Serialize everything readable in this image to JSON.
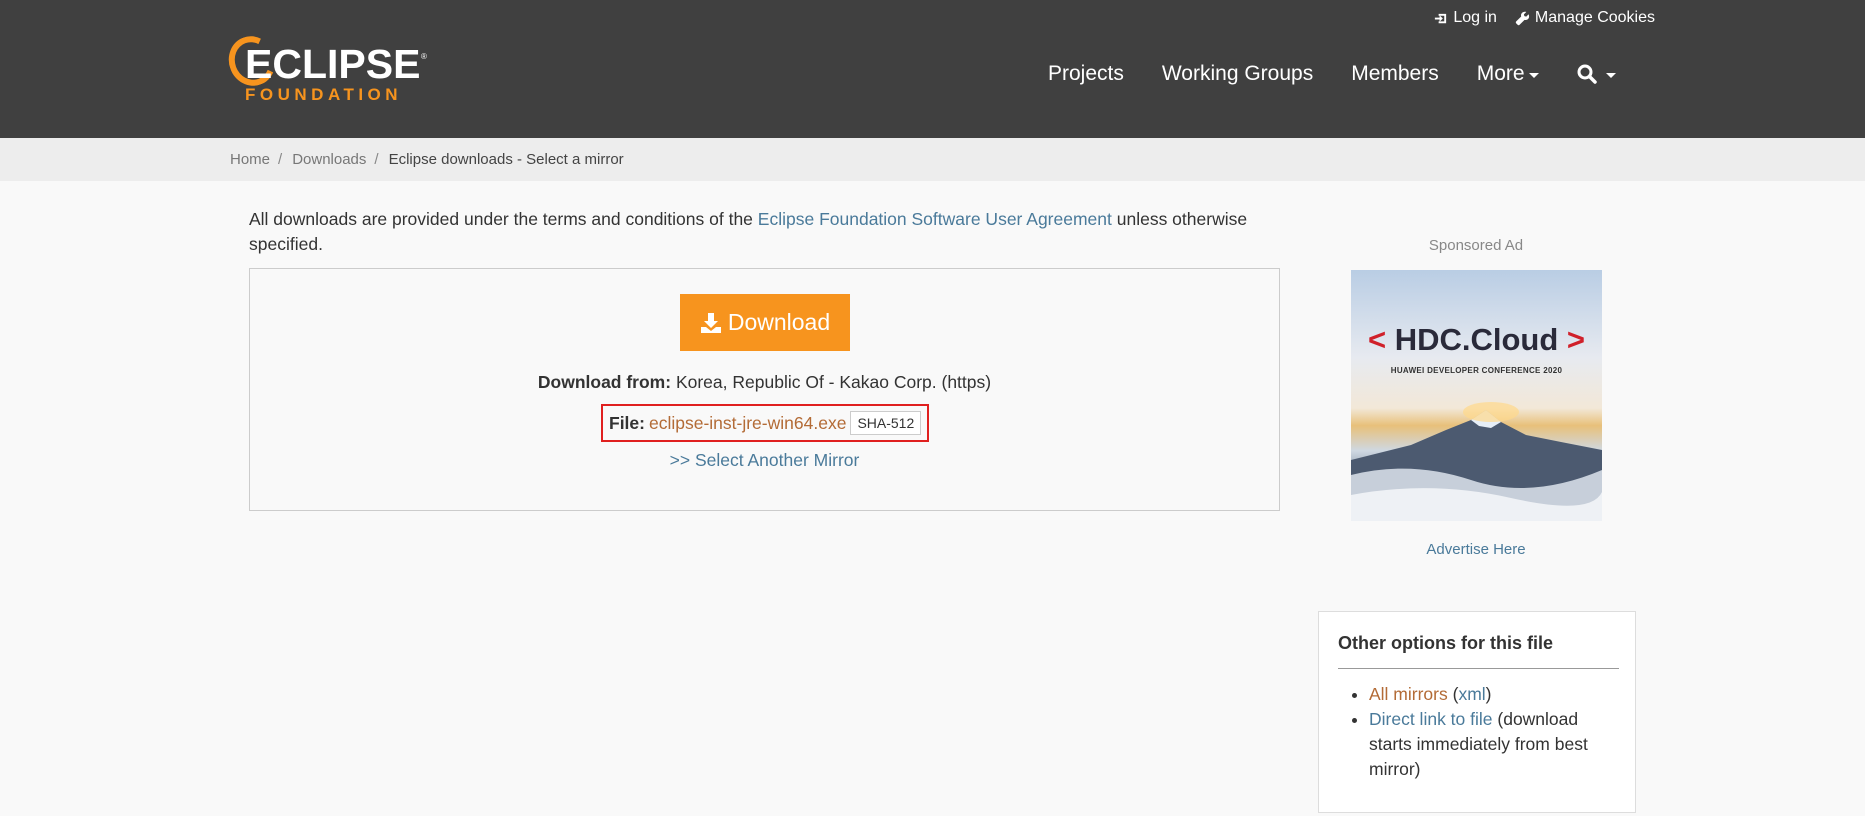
{
  "header": {
    "top_links": [
      {
        "label": "Log in",
        "icon": "sign-in-icon"
      },
      {
        "label": "Manage Cookies",
        "icon": "wrench-icon"
      }
    ],
    "logo": {
      "main": "ECLIPSE",
      "reg": "®",
      "sub": "FOUNDATION"
    },
    "nav": [
      "Projects",
      "Working Groups",
      "Members",
      "More"
    ]
  },
  "breadcrumb": {
    "items": [
      "Home",
      "Downloads"
    ],
    "separator": "/",
    "current": "Eclipse downloads - Select a mirror"
  },
  "intro": {
    "before": "All downloads are provided under the terms and conditions of the ",
    "link": "Eclipse Foundation Software User Agreement",
    "after": " unless otherwise specified."
  },
  "download": {
    "button_label": "Download",
    "from_label": "Download from:",
    "from_value": "Korea, Republic Of - Kakao Corp. (https)",
    "file_label": "File:",
    "file_name": "eclipse-inst-jre-win64.exe",
    "sha_label": "SHA-512",
    "mirror_link": ">> Select Another Mirror",
    "accent_color": "#f7941e",
    "highlight_color": "#e0201f"
  },
  "sidebar": {
    "sponsored_label": "Sponsored Ad",
    "ad": {
      "title_left": "<",
      "title": "HDC.Cloud",
      "title_right": ">",
      "subtitle": "HUAWEI DEVELOPER CONFERENCE 2020"
    },
    "advertise_label": "Advertise Here",
    "options": {
      "title": "Other options for this file",
      "all_mirrors": "All mirrors",
      "xml_open": " (",
      "xml": "xml",
      "xml_close": ")",
      "direct_link": "Direct link to file",
      "direct_desc": " (download starts immediately from best mirror)"
    }
  }
}
